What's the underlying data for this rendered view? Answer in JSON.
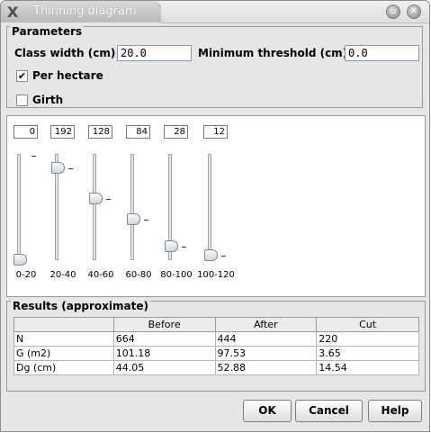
{
  "window": {
    "title": "Thinning diagram"
  },
  "parameters": {
    "legend": "Parameters",
    "class_width_label": "Class width (cm) :",
    "class_width_value": "20.0",
    "min_threshold_label": "Minimum threshold (cm) :",
    "min_threshold_value": "0.0",
    "per_hectare_label": "Per hectare",
    "per_hectare_checked": true,
    "girth_label": "Girth",
    "girth_checked": false
  },
  "sliders": [
    {
      "range": "0-20",
      "value": "0"
    },
    {
      "range": "20-40",
      "value": "192"
    },
    {
      "range": "40-60",
      "value": "128"
    },
    {
      "range": "60-80",
      "value": "84"
    },
    {
      "range": "80-100",
      "value": "28"
    },
    {
      "range": "100-120",
      "value": "12"
    }
  ],
  "results": {
    "legend": "Results (approximate)",
    "columns": [
      "",
      "Before",
      "After",
      "Cut"
    ],
    "rows": [
      [
        "N",
        "664",
        "444",
        "220"
      ],
      [
        "G (m2)",
        "101.18",
        "97.53",
        "3.65"
      ],
      [
        "Dg (cm)",
        "44.05",
        "52.88",
        "14.54"
      ]
    ]
  },
  "buttons": {
    "ok": "OK",
    "cancel": "Cancel",
    "help": "Help"
  }
}
